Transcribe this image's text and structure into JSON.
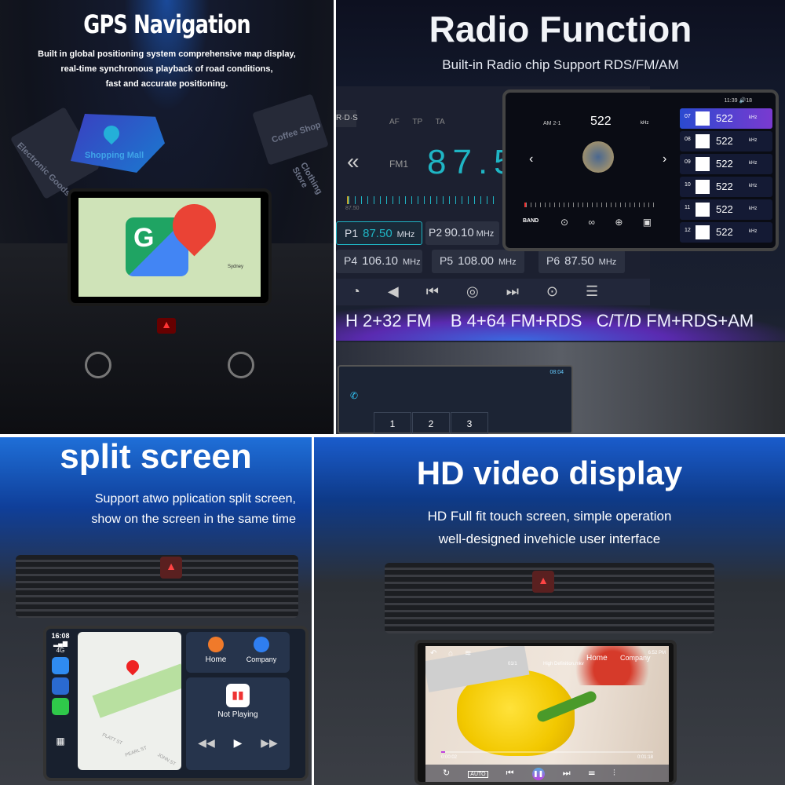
{
  "gps_panel": {
    "title": "GPS Navigation",
    "description": [
      "Built in global positioning system comprehensive map display,",
      "real-time synchronous playback of road conditions,",
      "fast and accurate positioning."
    ],
    "map_labels": {
      "shopping_mall": "Shopping Mall",
      "coffee_shop": "Coffee Shop",
      "electronic_goods": "Electronic Goods",
      "clothing_store": "Clothing Store"
    },
    "maps_logo_letter": "G",
    "map_city": "Sydney"
  },
  "radio_panel": {
    "title": "Radio Function",
    "subtitle": "Built-in Radio chip Support RDS/FM/AM",
    "rds_badge": "R·D·S",
    "toggles": [
      "AF",
      "TP",
      "TA"
    ],
    "band": "FM1",
    "frequency": "87.5",
    "scale_start": "87.50",
    "presets": [
      {
        "id": "P1",
        "freq": "87.50",
        "unit": "MHz",
        "active": true
      },
      {
        "id": "P2",
        "freq": "90.10",
        "unit": "MHz"
      },
      {
        "id": "P4",
        "freq": "106.10",
        "unit": "MHz"
      },
      {
        "id": "P5",
        "freq": "108.00",
        "unit": "MHz"
      },
      {
        "id": "P6",
        "freq": "87.50",
        "unit": "MHz"
      }
    ],
    "inset": {
      "status_time": "11:39",
      "status_volume": "18",
      "band": "AM 2-1",
      "frequency": "522",
      "unit": "kHz",
      "band_button": "BAND",
      "stations": [
        {
          "num": "07",
          "freq": "522",
          "unit": "kHz",
          "active": true
        },
        {
          "num": "08",
          "freq": "522",
          "unit": "kHz"
        },
        {
          "num": "09",
          "freq": "522",
          "unit": "kHz"
        },
        {
          "num": "10",
          "freq": "522",
          "unit": "kHz"
        },
        {
          "num": "11",
          "freq": "522",
          "unit": "kHz"
        },
        {
          "num": "12",
          "freq": "522",
          "unit": "kHz"
        }
      ]
    },
    "versions": "H 2+32 FM    B 4+64 FM+RDS   C/T/D FM+RDS+AM",
    "dialer": {
      "time": "08:04",
      "keys": [
        "1",
        "2",
        "3"
      ]
    }
  },
  "split_panel": {
    "title": "split screen",
    "description": [
      "Support atwo pplication split screen,",
      "show on the screen in the same time"
    ],
    "carplay": {
      "time": "16:08",
      "signal": "4G",
      "shortcuts": [
        {
          "label": "Home",
          "color": "#f07a2a"
        },
        {
          "label": "Company",
          "color": "#2f7ef0"
        }
      ],
      "now_playing": "Not Playing",
      "map_streets": [
        "PLATT ST",
        "PEARL ST",
        "JOHN ST"
      ]
    }
  },
  "video_panel": {
    "title": "HD video display",
    "description": [
      "HD Full fit touch screen, simple operation",
      "well-designed invehicle user interface"
    ],
    "player": {
      "status_time": "6:52 PM",
      "overlay_home": "Home",
      "overlay_company": "Company",
      "track_index": "01/1",
      "file_name": "High Definition.mkv",
      "elapsed": "0:00:02",
      "duration": "0:01:18",
      "auto_label": "AUTO",
      "progress_percent": 2
    }
  },
  "colors": {
    "accent_teal": "#1fb5c4",
    "active_preset": "#5b3fd0",
    "pause_button": "#c040e0"
  }
}
